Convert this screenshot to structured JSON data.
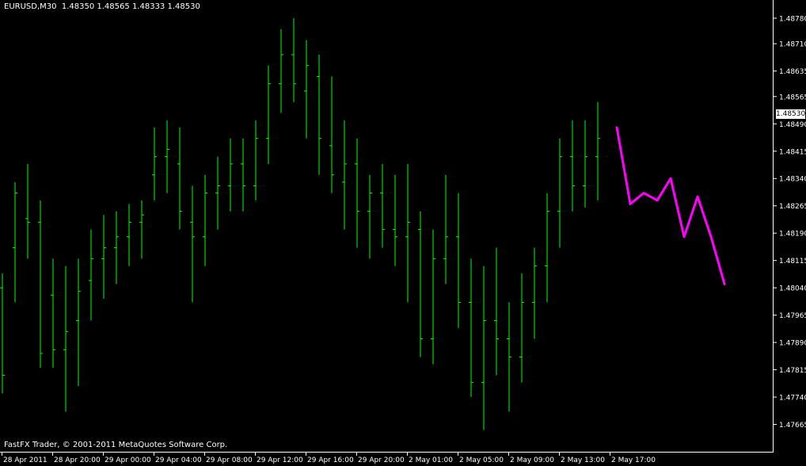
{
  "header": {
    "symbol": "EURUSD,M30",
    "open": "1.48350",
    "high": "1.48565",
    "low": "1.48333",
    "close": "1.48530"
  },
  "footer": {
    "copyright": "FastFX Trader, © 2001-2011 MetaQuotes Software Corp."
  },
  "current_price": "1.48530",
  "colors": {
    "background": "#000000",
    "bars": "#00ff00",
    "forecast": "#ff00ff",
    "axis": "#ffffff"
  },
  "chart_data": {
    "type": "line",
    "title": "EURUSD,M30",
    "ylim": [
      1.4759,
      1.4883
    ],
    "y_ticks": [
      "1.48780",
      "1.48710",
      "1.48635",
      "1.48565",
      "1.48490",
      "1.48415",
      "1.48340",
      "1.48265",
      "1.48190",
      "1.48115",
      "1.48040",
      "1.47965",
      "1.47890",
      "1.47815",
      "1.47740",
      "1.47665"
    ],
    "x_ticks": [
      "28 Apr 2011",
      "28 Apr 20:00",
      "29 Apr 00:00",
      "29 Apr 04:00",
      "29 Apr 08:00",
      "29 Apr 12:00",
      "29 Apr 16:00",
      "29 Apr 20:00",
      "2 May 01:00",
      "2 May 05:00",
      "2 May 09:00",
      "2 May 13:00",
      "2 May 17:00"
    ],
    "series": [
      {
        "type": "ohlc",
        "values": [
          [
            1.4804,
            1.4808,
            1.4775,
            1.478
          ],
          [
            1.4815,
            1.4833,
            1.48,
            1.483
          ],
          [
            1.4823,
            1.4838,
            1.4812,
            1.4822
          ],
          [
            1.4822,
            1.4828,
            1.4782,
            1.4786
          ],
          [
            1.4802,
            1.4812,
            1.4782,
            1.4787
          ],
          [
            1.4787,
            1.481,
            1.477,
            1.4792
          ],
          [
            1.4795,
            1.4812,
            1.4777,
            1.4803
          ],
          [
            1.4806,
            1.482,
            1.4795,
            1.4812
          ],
          [
            1.4812,
            1.4824,
            1.4801,
            1.4815
          ],
          [
            1.4815,
            1.4825,
            1.4805,
            1.4818
          ],
          [
            1.4818,
            1.4827,
            1.481,
            1.4822
          ],
          [
            1.4822,
            1.4828,
            1.4812,
            1.4824
          ],
          [
            1.4835,
            1.4848,
            1.4828,
            1.484
          ],
          [
            1.484,
            1.485,
            1.483,
            1.4842
          ],
          [
            1.4838,
            1.4848,
            1.482,
            1.4825
          ],
          [
            1.4822,
            1.4832,
            1.48,
            1.4818
          ],
          [
            1.4818,
            1.4835,
            1.481,
            1.483
          ],
          [
            1.483,
            1.484,
            1.482,
            1.4832
          ],
          [
            1.4832,
            1.4845,
            1.4825,
            1.4838
          ],
          [
            1.4838,
            1.4845,
            1.4825,
            1.4832
          ],
          [
            1.4832,
            1.485,
            1.4828,
            1.4845
          ],
          [
            1.4845,
            1.4865,
            1.4838,
            1.486
          ],
          [
            1.486,
            1.4875,
            1.4852,
            1.4868
          ],
          [
            1.4868,
            1.4878,
            1.4855,
            1.486
          ],
          [
            1.4858,
            1.4872,
            1.4845,
            1.4865
          ],
          [
            1.4862,
            1.4868,
            1.4835,
            1.4845
          ],
          [
            1.4843,
            1.4862,
            1.483,
            1.4835
          ],
          [
            1.4833,
            1.485,
            1.482,
            1.4838
          ],
          [
            1.4838,
            1.4845,
            1.4815,
            1.4825
          ],
          [
            1.4825,
            1.4835,
            1.4812,
            1.483
          ],
          [
            1.483,
            1.4838,
            1.4815,
            1.482
          ],
          [
            1.482,
            1.4835,
            1.481,
            1.4818
          ],
          [
            1.4818,
            1.4838,
            1.48,
            1.4822
          ],
          [
            1.482,
            1.4825,
            1.4785,
            1.479
          ],
          [
            1.479,
            1.482,
            1.4783,
            1.4812
          ],
          [
            1.4812,
            1.4835,
            1.4805,
            1.4818
          ],
          [
            1.4818,
            1.483,
            1.4793,
            1.48
          ],
          [
            1.48,
            1.4812,
            1.4774,
            1.4778
          ],
          [
            1.4778,
            1.481,
            1.4765,
            1.4795
          ],
          [
            1.4795,
            1.4815,
            1.478,
            1.479
          ],
          [
            1.479,
            1.48,
            1.477,
            1.4785
          ],
          [
            1.4785,
            1.4808,
            1.4778,
            1.48
          ],
          [
            1.48,
            1.4815,
            1.479,
            1.481
          ],
          [
            1.481,
            1.483,
            1.48,
            1.4825
          ],
          [
            1.4825,
            1.4845,
            1.4815,
            1.484
          ],
          [
            1.484,
            1.485,
            1.4825,
            1.4832
          ],
          [
            1.4832,
            1.485,
            1.4826,
            1.484
          ],
          [
            1.484,
            1.4855,
            1.4828,
            1.4845
          ]
        ]
      },
      {
        "name": "forecast",
        "type": "line",
        "values": [
          1.4848,
          1.4827,
          1.483,
          1.4828,
          1.4834,
          1.4818,
          1.4829,
          1.4818,
          1.4805
        ]
      }
    ],
    "grid": false,
    "legend": "none"
  }
}
